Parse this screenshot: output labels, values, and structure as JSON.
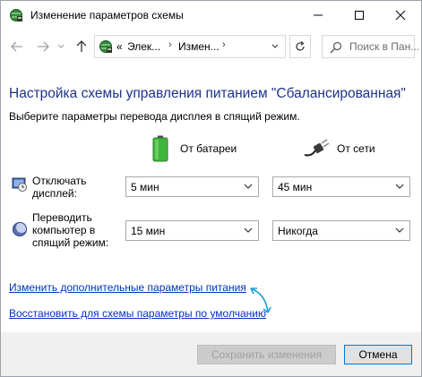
{
  "window": {
    "title": "Изменение параметров схемы",
    "controls": {
      "minimize": "minimize",
      "maximize": "maximize",
      "close": "close"
    }
  },
  "navigation": {
    "breadcrumb_prefix": "«",
    "crumbs": [
      "Элек...",
      "Измен..."
    ],
    "crumb_separator": "›",
    "search_placeholder": "Поиск в Пан..."
  },
  "main": {
    "heading": "Настройка схемы управления питанием \"Сбалансированная\"",
    "subtitle": "Выберите параметры перевода дисплея в спящий режим.",
    "columns": {
      "battery": "От батареи",
      "plugged": "От сети"
    },
    "rows": [
      {
        "label_line1": "Отключать",
        "label_line2": "дисплей:",
        "label_line3": "",
        "battery_value": "5 мин",
        "plugged_value": "45 мин",
        "icon": "display-icon"
      },
      {
        "label_line1": "Переводить",
        "label_line2": "компьютер в",
        "label_line3": "спящий режим:",
        "battery_value": "15 мин",
        "plugged_value": "Никогда",
        "icon": "sleep-icon"
      }
    ],
    "links": {
      "advanced": "Изменить дополнительные параметры питания",
      "restore": "Восстановить для схемы параметры по умолчанию"
    }
  },
  "footer": {
    "save_label": "Сохранить изменения",
    "cancel_label": "Отмена"
  },
  "colors": {
    "heading": "#1e3287",
    "link": "#0033bb",
    "annotation_arrow": "#1a9fd6"
  }
}
